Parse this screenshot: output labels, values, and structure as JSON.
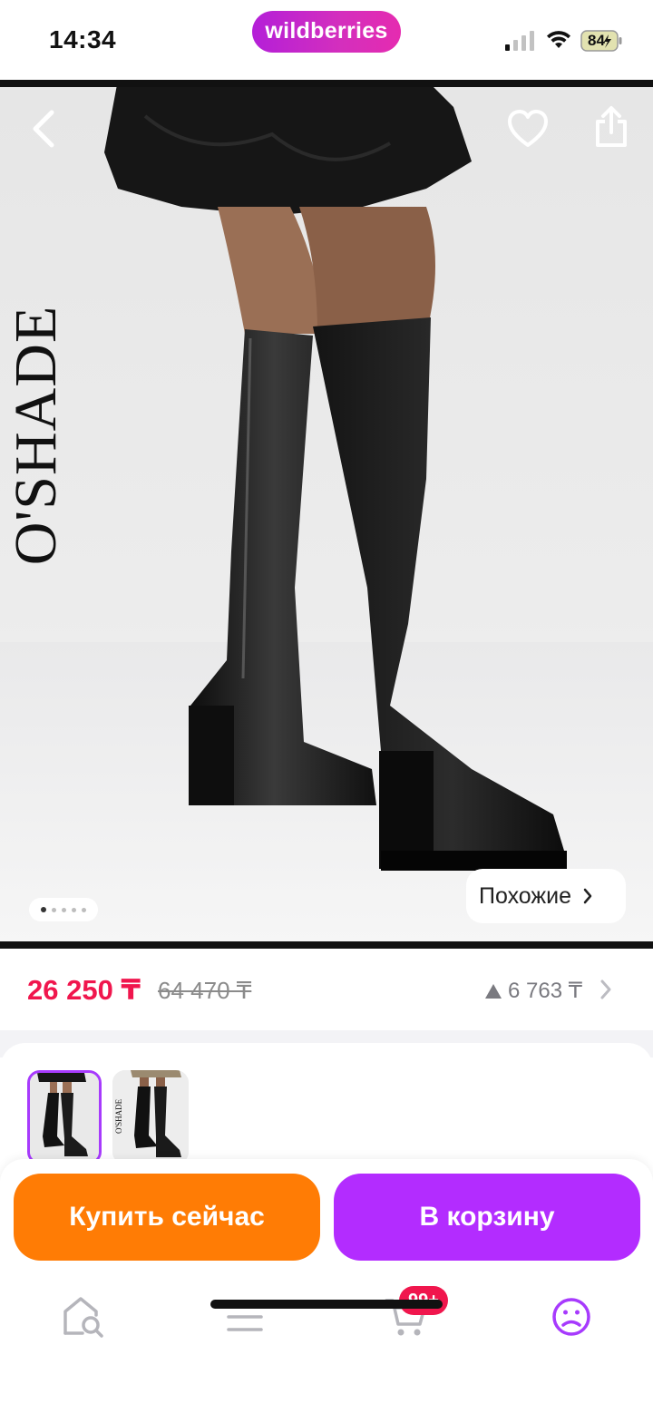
{
  "status_bar": {
    "time": "14:34",
    "app_badge": "wildberries",
    "battery": "84"
  },
  "product": {
    "brand_watermark": "O'SHADE",
    "similar_label": "Похожие",
    "gallery_pages": 5,
    "gallery_active_page": 1
  },
  "price": {
    "current": "26 250 ₸",
    "old": "64 470 ₸",
    "delta": "6 763 ₸"
  },
  "thumbnails": [
    {
      "name": "boots-photo-1",
      "active": true
    },
    {
      "name": "boots-photo-2",
      "active": false
    }
  ],
  "actions": {
    "buy_now": "Купить сейчас",
    "add_to_cart": "В корзину"
  },
  "nav": {
    "cart_badge": "99+",
    "items": [
      "home-search",
      "catalog",
      "cart",
      "profile"
    ]
  },
  "colors": {
    "brand_purple": "#b32cff",
    "buy_orange": "#ff7c05",
    "price_red": "#f0164d"
  }
}
